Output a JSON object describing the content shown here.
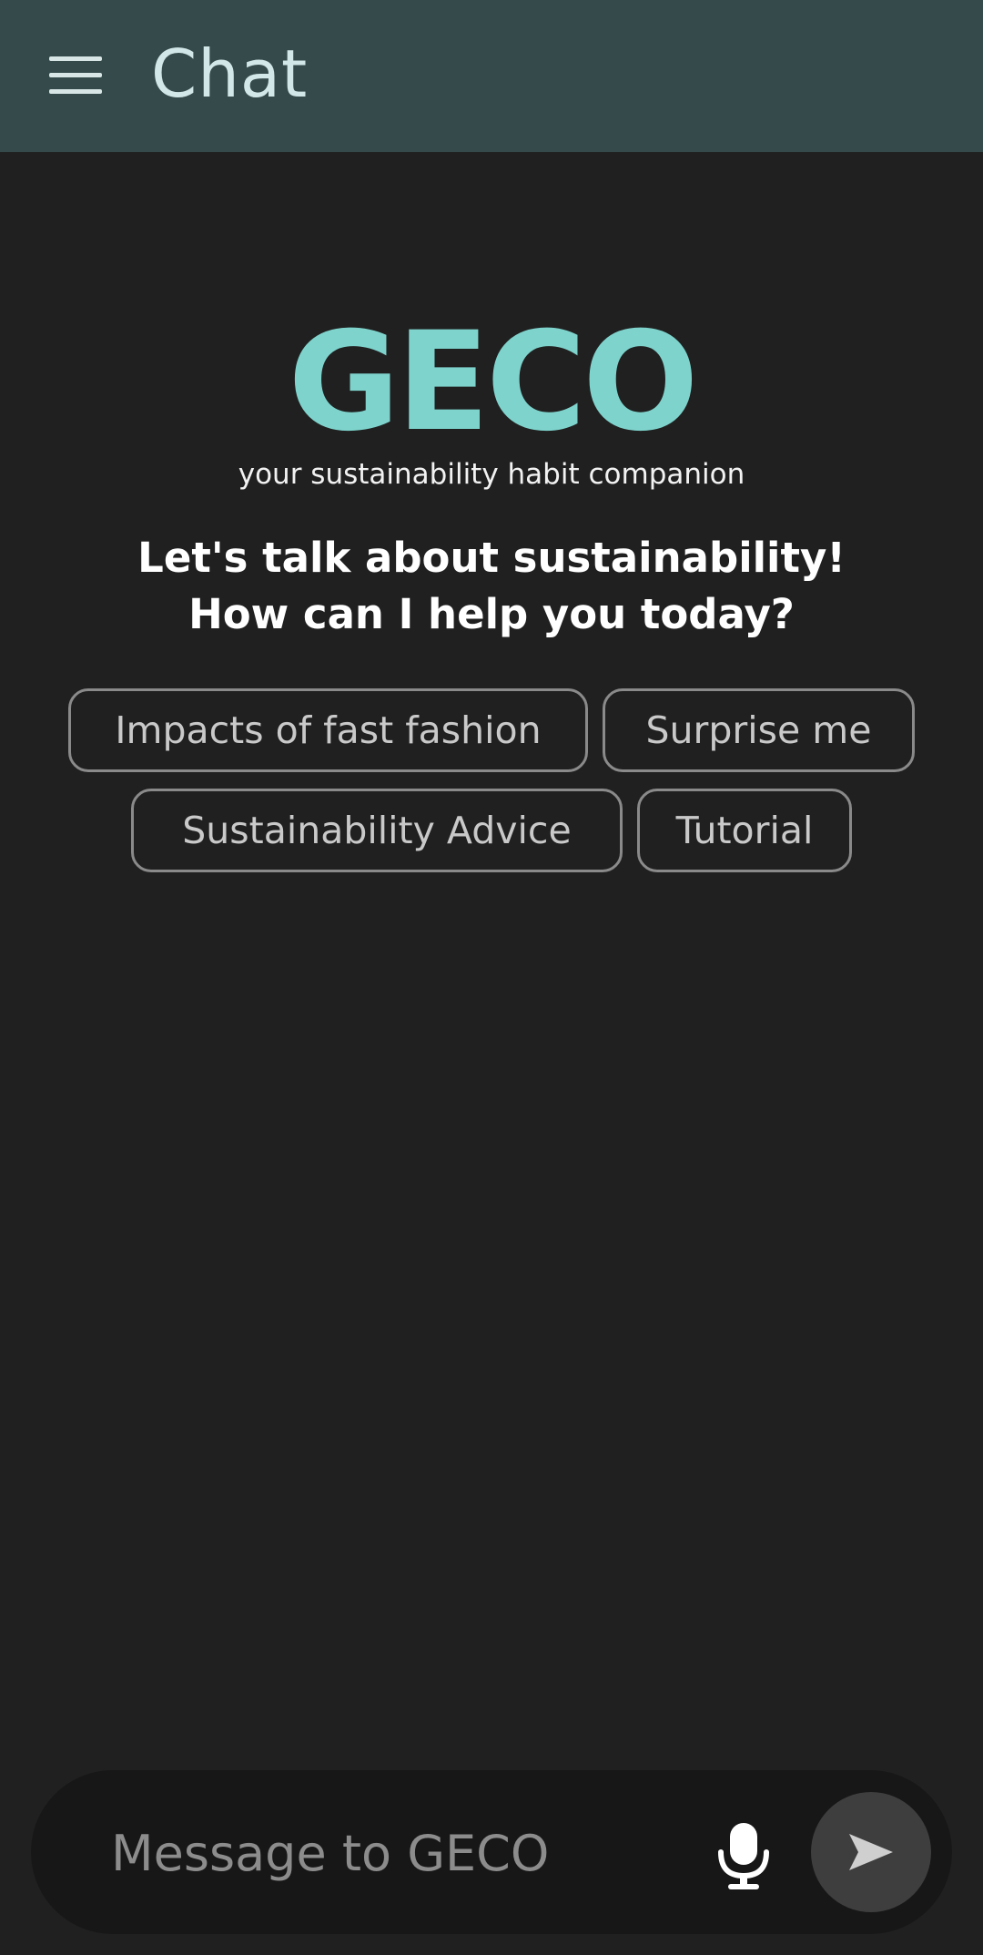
{
  "appbar": {
    "title": "Chat",
    "menu_icon": "hamburger-menu-icon",
    "background": "#354b4b"
  },
  "hero": {
    "logo": "GECO",
    "tagline": "your sustainability habit companion",
    "greeting_line1": "Let's talk about sustainability!",
    "greeting_line2": "How can I help you today?",
    "logo_color": "#7ed4cd"
  },
  "suggestions": [
    {
      "label": "Impacts of fast fashion"
    },
    {
      "label": "Surprise me"
    },
    {
      "label": "Sustainability Advice"
    },
    {
      "label": "Tutorial"
    }
  ],
  "composer": {
    "placeholder": "Message to GECO",
    "mic_icon": "microphone-icon",
    "send_icon": "send-icon"
  }
}
